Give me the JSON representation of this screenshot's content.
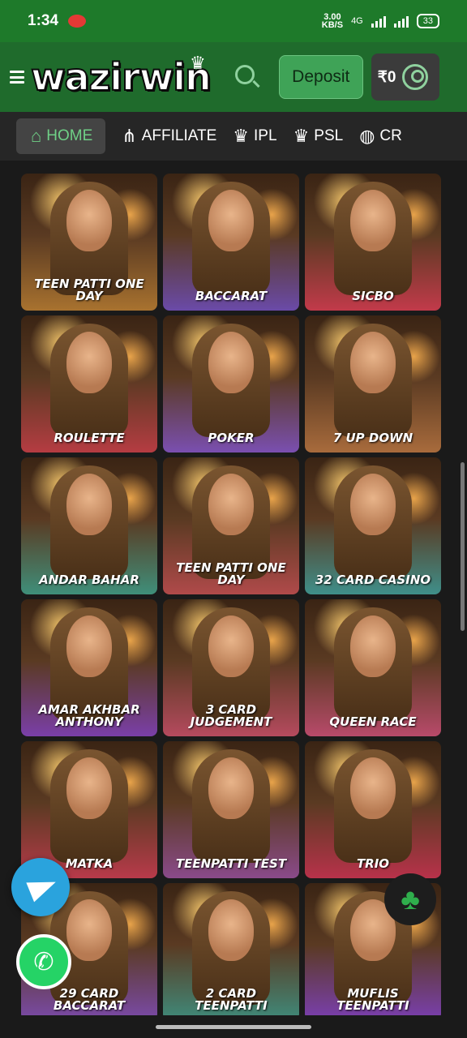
{
  "status": {
    "time": "1:34",
    "speed": "3.00",
    "speed_unit": "KB/S",
    "network": "4G",
    "battery": "33"
  },
  "header": {
    "logo": "wazirwin",
    "deposit_label": "Deposit",
    "balance": "₹0"
  },
  "tabs": [
    {
      "label": "HOME",
      "icon": "home-icon",
      "active": true
    },
    {
      "label": "AFFILIATE",
      "icon": "share-icon"
    },
    {
      "label": "IPL",
      "icon": "trophy-icon"
    },
    {
      "label": "PSL",
      "icon": "trophy-icon"
    },
    {
      "label": "CR",
      "icon": "cricket-icon"
    }
  ],
  "games": [
    {
      "label": "TEEN PATTI ONE DAY",
      "theme": "#a8722f"
    },
    {
      "label": "BACCARAT",
      "theme": "#6a4aa8"
    },
    {
      "label": "SICBO",
      "theme": "#c23a4a"
    },
    {
      "label": "ROULETTE",
      "theme": "#b53c42"
    },
    {
      "label": "POKER",
      "theme": "#7a4fb0"
    },
    {
      "label": "7 UP DOWN",
      "theme": "#a86b3c"
    },
    {
      "label": "ANDAR BAHAR",
      "theme": "#3f8f7a"
    },
    {
      "label": "TEEN PATTI ONE DAY",
      "theme": "#b04a4a"
    },
    {
      "label": "32 CARD CASINO",
      "theme": "#3f8f8a"
    },
    {
      "label": "AMAR AKHBAR ANTHONY",
      "theme": "#7a3fa8"
    },
    {
      "label": "3 CARD JUDGEMENT",
      "theme": "#b54a5e"
    },
    {
      "label": "QUEEN RACE",
      "theme": "#b84a6a"
    },
    {
      "label": "MATKA",
      "theme": "#b83a4a"
    },
    {
      "label": "TEENPATTI TEST",
      "theme": "#8a4a8a"
    },
    {
      "label": "TRIO",
      "theme": "#b8324a"
    },
    {
      "label": "29 CARD BACCARAT",
      "theme": "#7a4aa8"
    },
    {
      "label": "2 CARD TEENPATTI",
      "theme": "#3f8a7a"
    },
    {
      "label": "MUFLIS TEENPATTI",
      "theme": "#7a3fb0"
    }
  ]
}
